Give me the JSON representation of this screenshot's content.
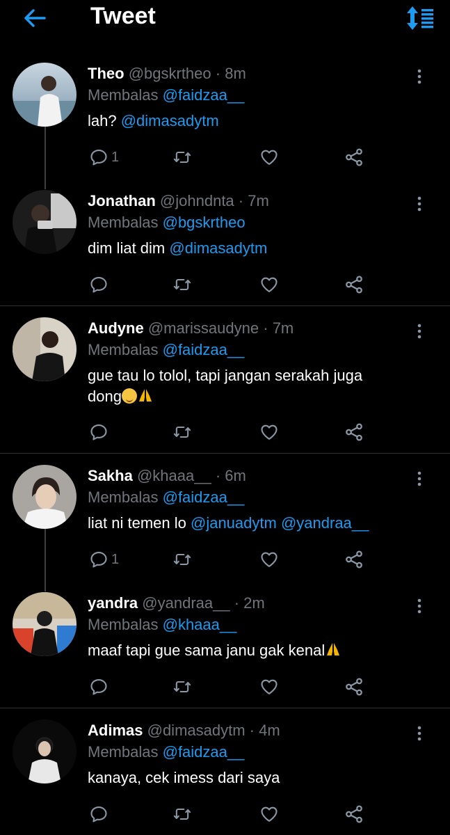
{
  "header": {
    "title": "Tweet"
  },
  "labels": {
    "replying_prefix": "Membalas"
  },
  "colors": {
    "accent": "#1d9bf0",
    "muted": "#71767b",
    "background": "#000000",
    "divider": "#2f3336"
  },
  "tweets": [
    {
      "name": "Theo",
      "handle": "@bgskrtheo",
      "dot": "·",
      "time": "8m",
      "reply_to": "@faidzaa__",
      "text": "lah?",
      "mention": "@dimasadytm",
      "reply_count": "1"
    },
    {
      "name": "Jonathan",
      "handle": "@johndnta",
      "dot": "·",
      "time": "7m",
      "reply_to": "@bgskrtheo",
      "text": "dim liat dim",
      "mention": "@dimasadytm",
      "reply_count": ""
    },
    {
      "name": "Audyne",
      "handle": "@marissaudyne",
      "dot": "·",
      "time": "7m",
      "reply_to": "@faidzaa__",
      "text_line1": "gue tau lo tolol, tapi jangan serakah juga",
      "text_line2": "dong",
      "reply_count": ""
    },
    {
      "name": "Sakha",
      "handle": "@khaaa__",
      "dot": "·",
      "time": "6m",
      "reply_to": "@faidzaa__",
      "text": "liat ni temen lo",
      "mention": "@januadytm",
      "mention2": "@yandraa__",
      "reply_count": "1"
    },
    {
      "name": "yandra",
      "handle": "@yandraa__",
      "dot": "·",
      "time": "2m",
      "reply_to": "@khaaa__",
      "text": "maaf tapi gue sama janu gak kenal",
      "reply_count": ""
    },
    {
      "name": "Adimas",
      "handle": "@dimasadytm",
      "dot": "·",
      "time": "4m",
      "reply_to": "@faidzaa__",
      "text": "kanaya, cek imess dari saya",
      "reply_count": ""
    }
  ]
}
